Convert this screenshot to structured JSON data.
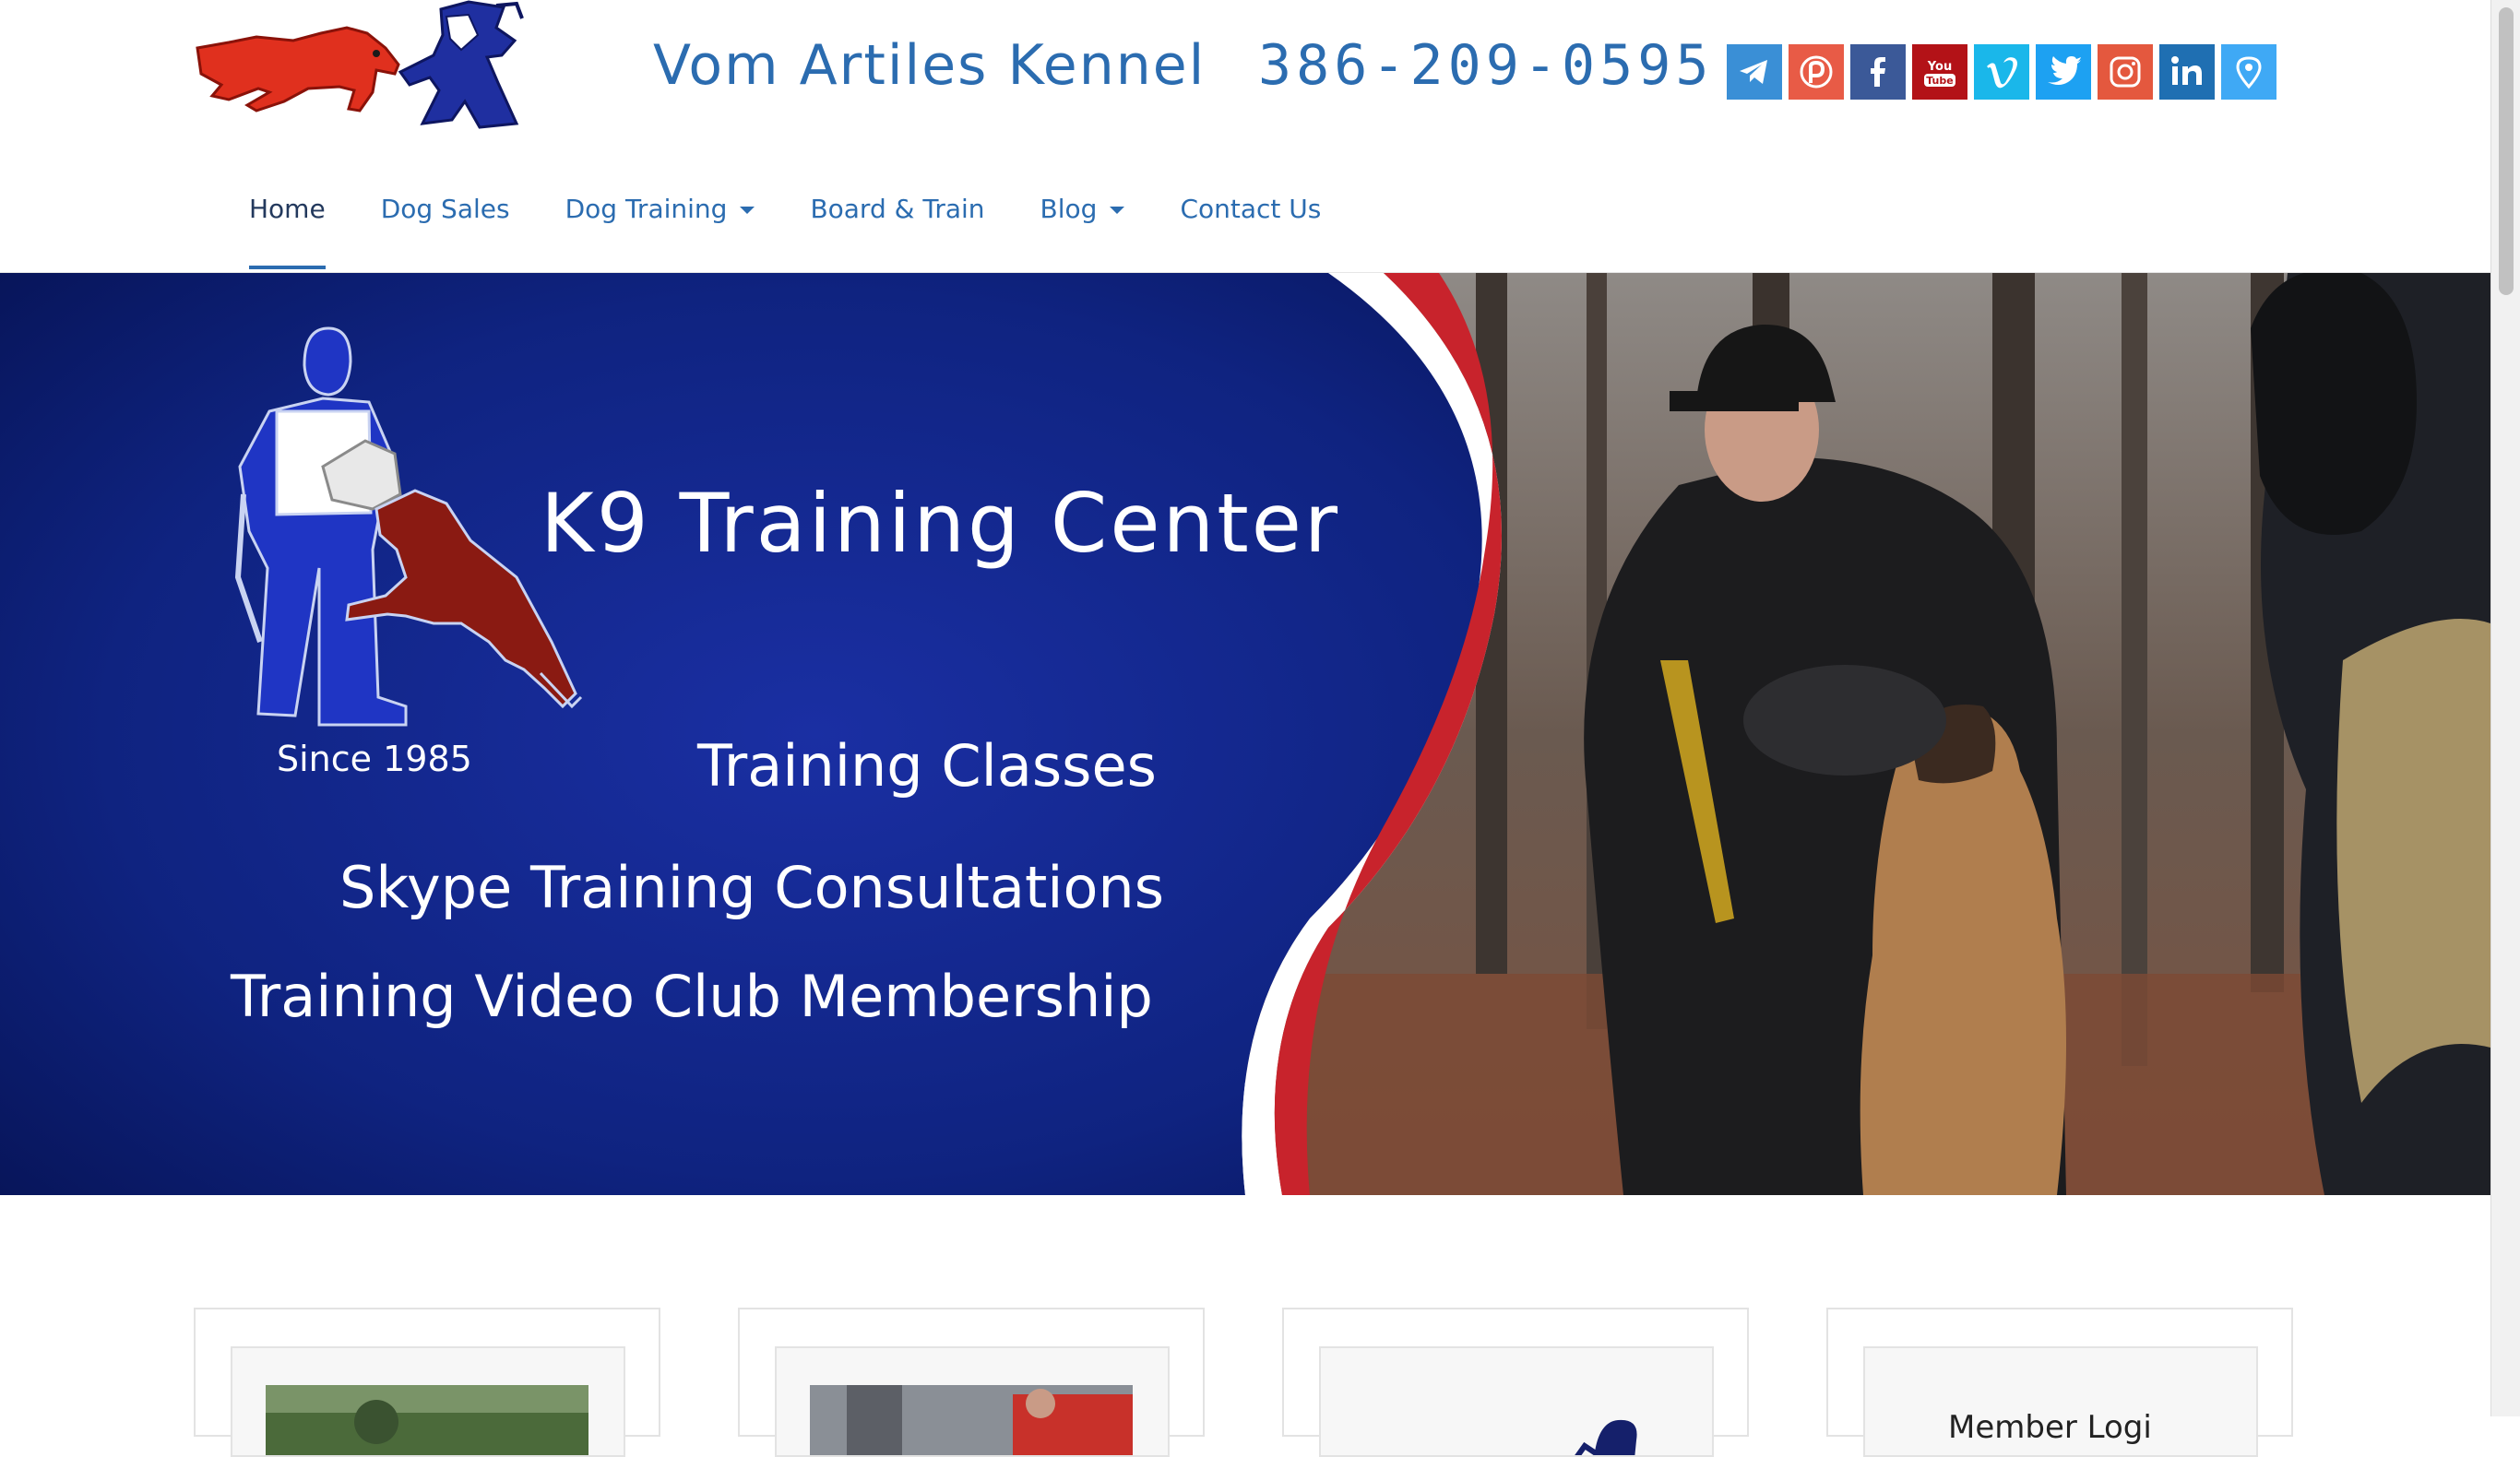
{
  "header": {
    "site_title": "Vom Artiles Kennel",
    "phone": "386-209-0595",
    "social": [
      {
        "icon": "telegram-icon",
        "color": "#3a8fd6"
      },
      {
        "icon": "patreon-icon",
        "color": "#e85b46"
      },
      {
        "icon": "facebook-icon",
        "color": "#3b5998"
      },
      {
        "icon": "youtube-icon",
        "color": "#b31217"
      },
      {
        "icon": "vimeo-icon",
        "color": "#1ab7ea"
      },
      {
        "icon": "twitter-icon",
        "color": "#1da1f2"
      },
      {
        "icon": "instagram-icon",
        "color": "#e4583e"
      },
      {
        "icon": "linkedin-icon",
        "color": "#1f6fb2"
      },
      {
        "icon": "map-pin-icon",
        "color": "#3fa9f5"
      }
    ]
  },
  "nav": {
    "items": [
      {
        "label": "Home"
      },
      {
        "label": "Dog Sales"
      },
      {
        "label": "Dog Training"
      },
      {
        "label": "Board & Train"
      },
      {
        "label": "Blog"
      },
      {
        "label": "Contact Us"
      }
    ]
  },
  "hero": {
    "title": "K9 Training Center",
    "since": "Since 1985",
    "lines": [
      "Training Classes",
      "Skype Training Consultations",
      "Training Video Club Membership"
    ],
    "colors": {
      "navy": "#0d1f6e",
      "red": "#c8232c",
      "white": "#ffffff"
    }
  },
  "cards": [
    {
      "text": ""
    },
    {
      "text": ""
    },
    {
      "text": ""
    },
    {
      "text": "Member Logi"
    }
  ]
}
